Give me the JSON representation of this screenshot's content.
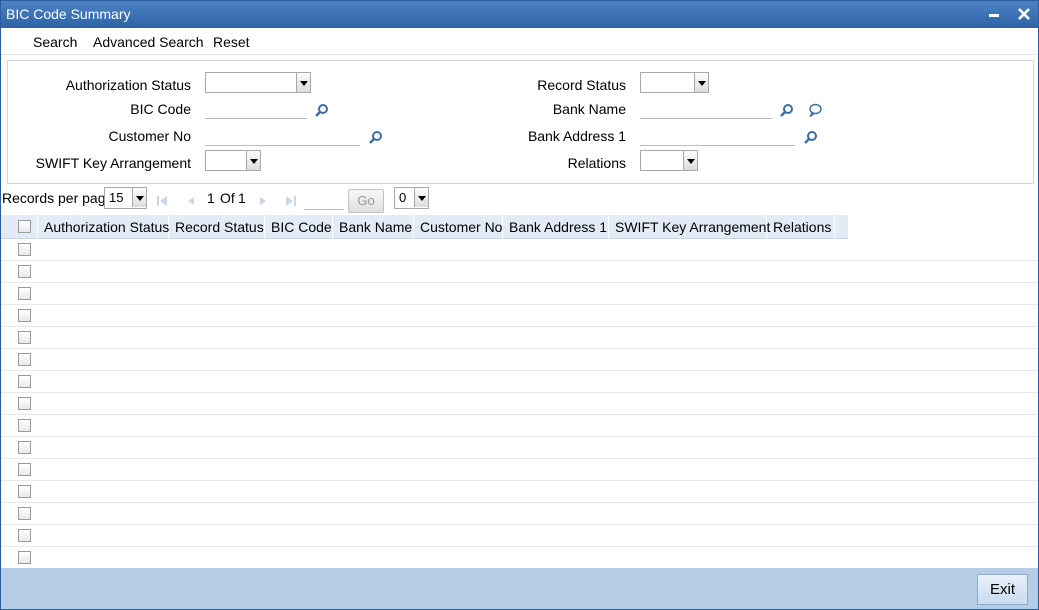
{
  "window": {
    "title": "BIC Code Summary"
  },
  "menu": {
    "search": "Search",
    "advanced_search": "Advanced Search",
    "reset": "Reset"
  },
  "filters": {
    "authorization_status_label": "Authorization Status",
    "bic_code_label": "BIC Code",
    "customer_no_label": "Customer No",
    "swift_key_label": "SWIFT Key Arrangement",
    "record_status_label": "Record Status",
    "bank_name_label": "Bank Name",
    "bank_address_label": "Bank Address 1",
    "relations_label": "Relations"
  },
  "pager": {
    "records_per_page_label": "Records per page",
    "records_per_page_value": "15",
    "current_page": "1",
    "of_label": "Of",
    "total_pages": "1",
    "go_label": "Go",
    "extra_select_value": "0"
  },
  "grid": {
    "columns": [
      "Authorization Status",
      "Record Status",
      "BIC Code",
      "Bank Name",
      "Customer No",
      "Bank Address 1",
      "SWIFT Key Arrangement",
      "Relations"
    ],
    "empty_rows": 15
  },
  "footer": {
    "exit_label": "Exit"
  },
  "colors": {
    "titlebar": "#2e63a6",
    "grid_header": "#e3ecf6",
    "footer": "#b6cde8"
  }
}
